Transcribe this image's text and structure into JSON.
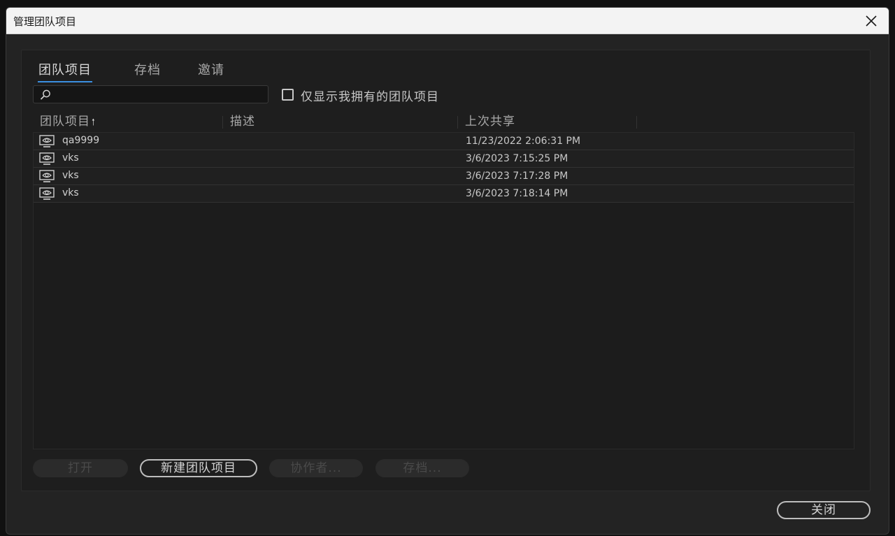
{
  "window": {
    "title": "管理团队项目"
  },
  "tabs": [
    {
      "label": "团队项目",
      "active": true
    },
    {
      "label": "存档",
      "active": false
    },
    {
      "label": "邀请",
      "active": false
    }
  ],
  "search": {
    "value": "",
    "placeholder": ""
  },
  "filter": {
    "only_mine_label": "仅显示我拥有的团队项目",
    "checked": false
  },
  "columns": [
    {
      "label": "团队项目",
      "sorted": "ascending",
      "sort_glyph": "🠑"
    },
    {
      "label": "描述"
    },
    {
      "label": "上次共享"
    }
  ],
  "rows": [
    {
      "name": "qa9999",
      "description": "",
      "last_shared": "11/23/2022 2:06:31 PM"
    },
    {
      "name": "vks",
      "description": "",
      "last_shared": "3/6/2023 7:15:25 PM"
    },
    {
      "name": "vks",
      "description": "",
      "last_shared": "3/6/2023 7:17:28 PM"
    },
    {
      "name": "vks",
      "description": "",
      "last_shared": "3/6/2023 7:18:14 PM"
    }
  ],
  "buttons": {
    "open": "打开",
    "new_team_project": "新建团队项目",
    "collaborators": "协作者...",
    "archive": "存档...",
    "close": "关闭"
  },
  "colors": {
    "accent": "#3b8fe0",
    "background": "#232323",
    "titlebar": "#f3f3f3"
  }
}
